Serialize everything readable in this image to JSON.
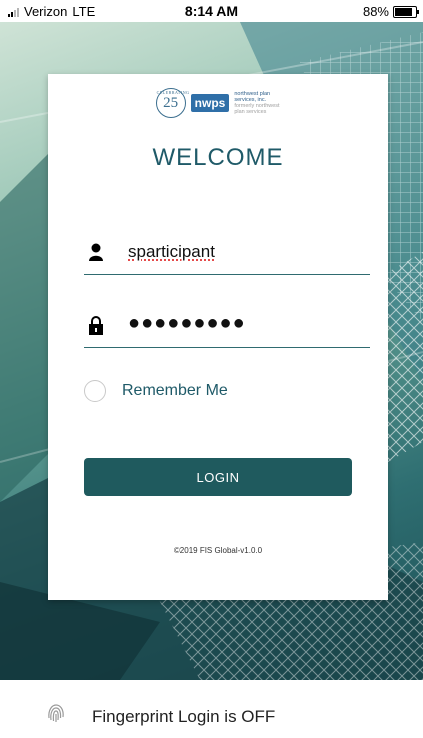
{
  "status_bar": {
    "carrier": "Verizon",
    "network": "LTE",
    "time": "8:14 AM",
    "battery_percent": "88%",
    "battery_level": 0.88
  },
  "brand": {
    "seal_number": "25",
    "seal_arc_text": "CELEBRATING",
    "seal_years_text": "YEARS",
    "logo_text": "nwps",
    "company_name": "northwest plan services, inc.",
    "tagline": "formerly northwest plan services",
    "accent_color": "#1f5a68",
    "button_color": "#1f5a5e"
  },
  "login": {
    "title": "WELCOME",
    "username_value": "sparticipant",
    "password_mask": "●●●●●●●●●",
    "remember_label": "Remember Me",
    "remember_checked": false,
    "login_button": "LOGIN",
    "copyright": "©2019 FIS Global-v1.0.0",
    "icons": {
      "username": "user-icon",
      "password": "lock-icon"
    }
  },
  "footer": {
    "fingerprint_label": "Fingerprint Login is OFF",
    "icon": "fingerprint-icon"
  }
}
